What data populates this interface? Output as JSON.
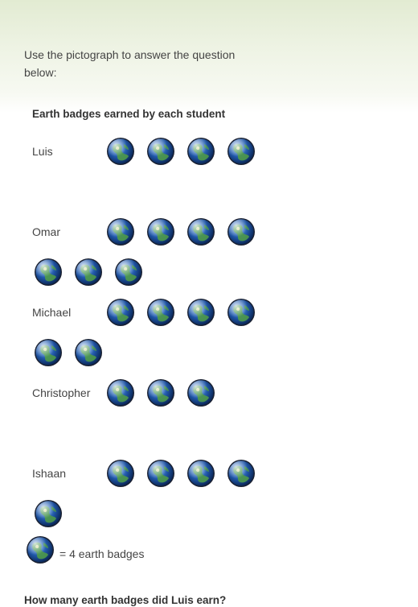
{
  "instructions": "Use the pictograph to answer the question below:",
  "question": "How many earth badges did Luis earn?",
  "chart_data": {
    "type": "pictograph",
    "title": "Earth badges earned by each student",
    "icon": "globe-icon",
    "categories": [
      "Luis",
      "Omar",
      "Michael",
      "Christopher",
      "Ishaan"
    ],
    "icon_counts": [
      4,
      7,
      6,
      3,
      5
    ],
    "key": {
      "icons": 1,
      "value": 4,
      "text": "= 4 earth badges"
    }
  }
}
